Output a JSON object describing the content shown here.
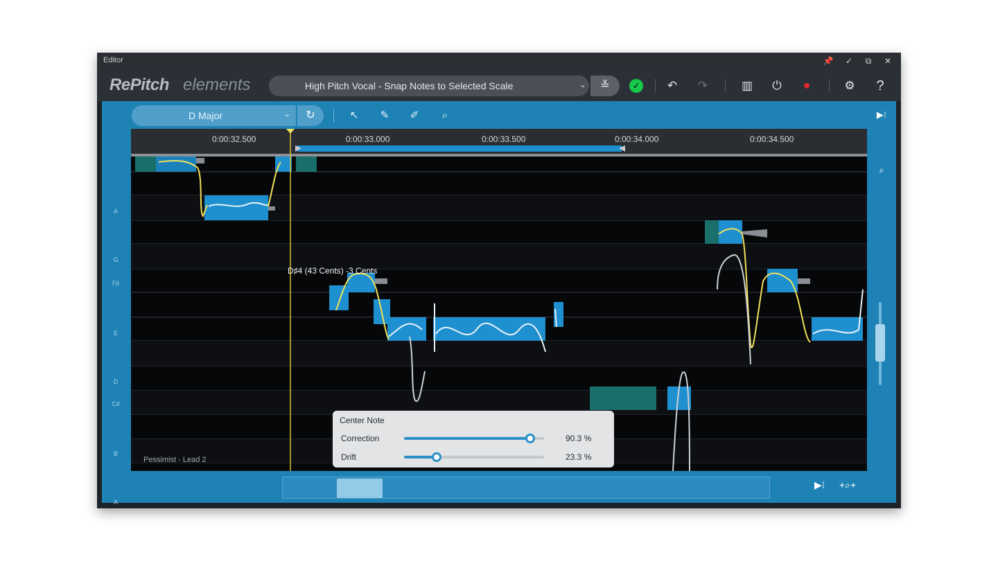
{
  "window": {
    "title": "Editor",
    "controls": [
      "📌",
      "✓",
      "⧉",
      "✕"
    ]
  },
  "toolbar": {
    "logo_main": "RePitch",
    "logo_sub": "elements",
    "preset": "High Pitch Vocal - Snap Notes to Selected Scale",
    "icons": {
      "preset_settings": "sliders-icon",
      "status": "check-circle-icon",
      "undo": "undo-icon",
      "redo": "redo-icon",
      "keyboard": "piano-keys-icon",
      "power": "power-icon",
      "record": "record-icon",
      "settings": "gear-icon",
      "help": "help-icon"
    },
    "glyphs": {
      "undo": "↶",
      "redo": "↷",
      "keyboard": "▥",
      "power": "⏻",
      "record": "⏺",
      "settings": "⚙",
      "help": "?",
      "check": "✓",
      "sliders": "≚"
    }
  },
  "editor": {
    "scale": "D Major",
    "tools": [
      "↖",
      "✎",
      "✐",
      "⌕"
    ],
    "ruler": [
      "0:00:32.500",
      "0:00:33.000",
      "0:00:33.500",
      "0:00:34.000",
      "0:00:34.500"
    ],
    "hover_text": "D♯4 (43 Cents) -3 Cents",
    "track_name": "Pessimist - Lead 2",
    "note_labels": [
      "A",
      "G",
      "F♯",
      "E",
      "D",
      "C♯",
      "B",
      "A"
    ]
  },
  "center_note": {
    "title": "Center Note",
    "correction_label": "Correction",
    "correction_value": "90.3 %",
    "correction_pct": 90.3,
    "drift_label": "Drift",
    "drift_value": "23.3 %",
    "drift_pct": 23.3
  },
  "colors": {
    "accent": "#1f82b5",
    "note_block": "#1e8fcf",
    "pitch_curve": "#f2e25a",
    "status_ok": "#17c94a"
  }
}
